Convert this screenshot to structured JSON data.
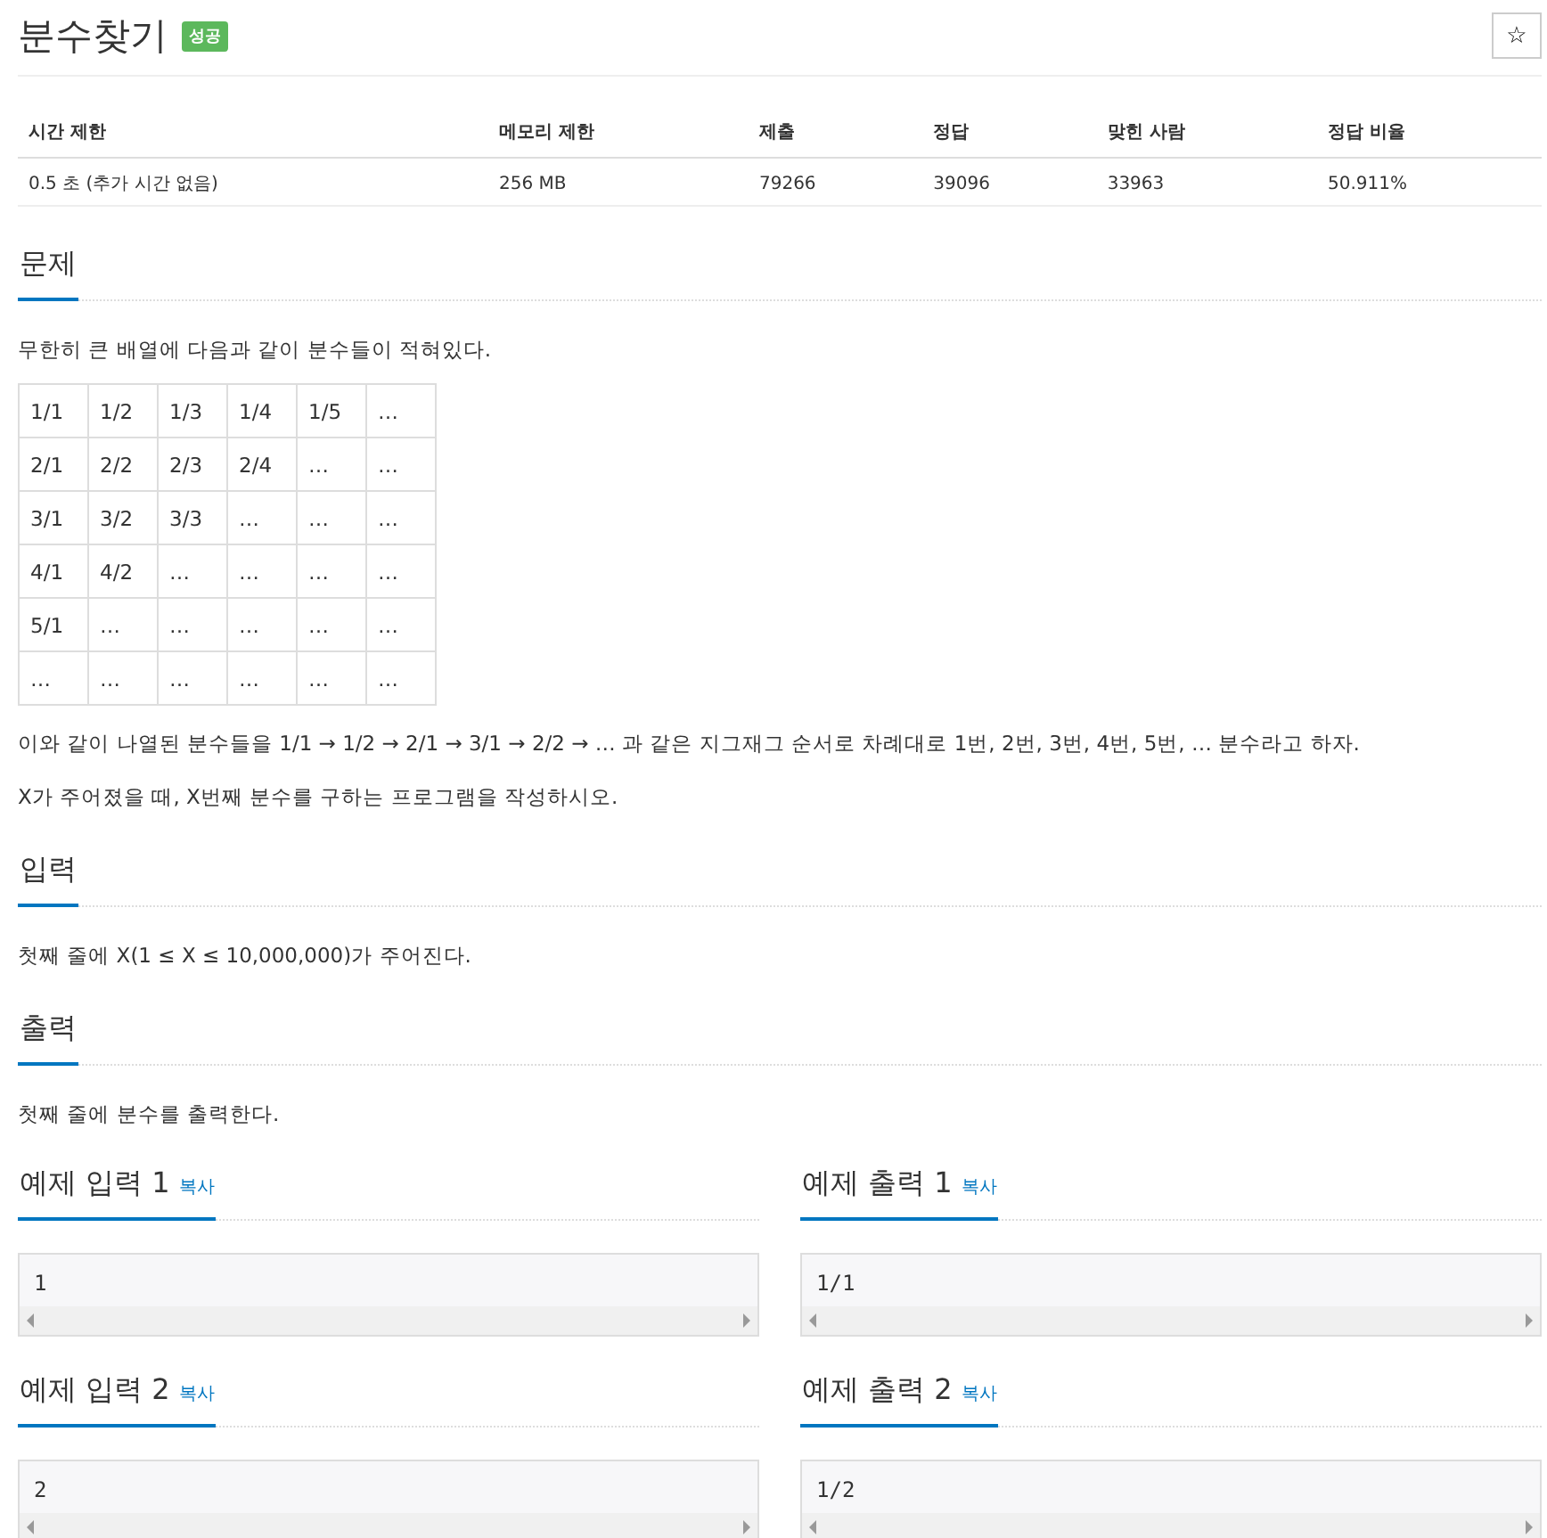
{
  "title": "분수찾기",
  "badge": "성공",
  "star_button": "☆",
  "stats": {
    "columns": [
      "시간 제한",
      "메모리 제한",
      "제출",
      "정답",
      "맞힌 사람",
      "정답 비율"
    ],
    "row": [
      "0.5 초 (추가 시간 없음)",
      "256 MB",
      "79266",
      "39096",
      "33963",
      "50.911%"
    ]
  },
  "problem": {
    "heading": "문제",
    "intro": "무한히 큰 배열에 다음과 같이 분수들이 적혀있다.",
    "grid": [
      [
        "1/1",
        "1/2",
        "1/3",
        "1/4",
        "1/5",
        "…"
      ],
      [
        "2/1",
        "2/2",
        "2/3",
        "2/4",
        "…",
        "…"
      ],
      [
        "3/1",
        "3/2",
        "3/3",
        "…",
        "…",
        "…"
      ],
      [
        "4/1",
        "4/2",
        "…",
        "…",
        "…",
        "…"
      ],
      [
        "5/1",
        "…",
        "…",
        "…",
        "…",
        "…"
      ],
      [
        "…",
        "…",
        "…",
        "…",
        "…",
        "…"
      ]
    ],
    "paragraphs": [
      "이와 같이 나열된 분수들을 1/1 → 1/2 → 2/1 → 3/1 → 2/2 → … 과 같은 지그재그 순서로 차례대로 1번, 2번, 3번, 4번, 5번, … 분수라고 하자.",
      "X가 주어졌을 때, X번째 분수를 구하는 프로그램을 작성하시오."
    ]
  },
  "sections": [
    {
      "heading": "입력",
      "text": "첫째 줄에 X(1 ≤ X ≤ 10,000,000)가 주어진다."
    },
    {
      "heading": "출력",
      "text": "첫째 줄에 분수를 출력한다."
    }
  ],
  "samples": [
    {
      "heading": "예제 입력 1",
      "copy": "복사",
      "value": "1"
    },
    {
      "heading": "예제 출력 1",
      "copy": "복사",
      "value": "1/1"
    },
    {
      "heading": "예제 입력 2",
      "copy": "복사",
      "value": "2"
    },
    {
      "heading": "예제 출력 2",
      "copy": "복사",
      "value": "1/2"
    }
  ]
}
